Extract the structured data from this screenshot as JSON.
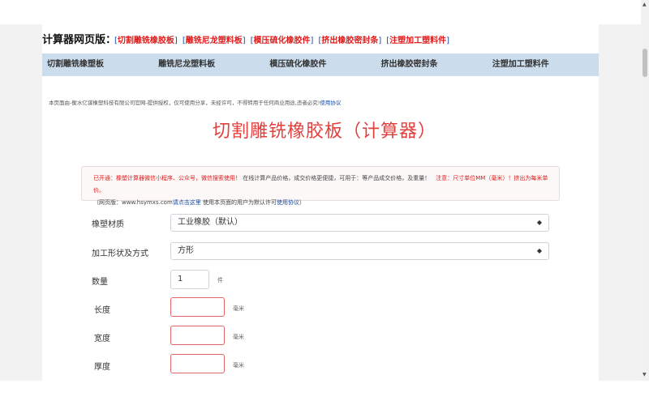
{
  "header": {
    "title": "计算器网页版：",
    "links": [
      "切割雕铣橡胶板",
      "雕铣尼龙塑料板",
      "模压硫化橡胶件",
      "挤出橡胶密封条",
      "注塑加工塑料件"
    ]
  },
  "nav": {
    "items": [
      "切割雕铣橡塑板",
      "雕铣尼龙塑料板",
      "模压硫化橡胶件",
      "挤出橡胶密封条",
      "注塑加工塑料件"
    ]
  },
  "notice": {
    "text": "本页面由-衡水亿谋橡塑科技有限公司官网-提供授权，仅可使用分享，未经许可，不得转用于任何商业用途,违者必究!",
    "link": "使用协议"
  },
  "page_title": "切割雕铣橡胶板（计算器）",
  "info": {
    "red1": "已开通：橡塑计算器微信小程序、公众号，微信搜索使用！",
    "text1": "在线计算产品价格，成交价格更便捷，可用于：等产品成交价格，及重量！",
    "red2": "注意：尺寸单位MM（毫米）！挤出为每米单价。",
    "text2": "（网页版：www.hsymxs.com",
    "link1": "请点击这里",
    "text3": "使用本页面的用户为默认许可",
    "link2": "使用协议",
    "text4": "）"
  },
  "form": {
    "material_label": "橡塑材质",
    "material_value": "工业橡胶（默认）",
    "shape_label": "加工形状及方式",
    "shape_value": "方形",
    "qty_label": "数量",
    "qty_value": "1",
    "qty_unit": "件",
    "length_label": "长度",
    "width_label": "宽度",
    "thickness_label": "厚度",
    "mm_unit": "毫米"
  }
}
